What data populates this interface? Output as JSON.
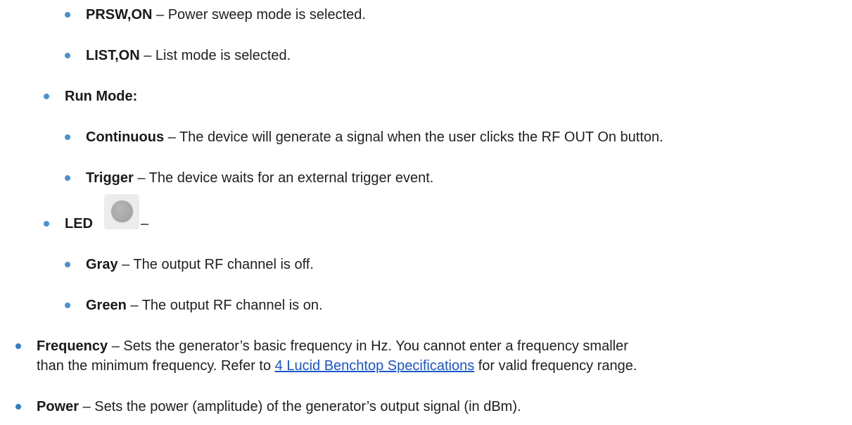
{
  "items": [
    {
      "term": "PRSW,ON",
      "sep": " – ",
      "desc": "Power sweep mode is selected."
    },
    {
      "term": "LIST,ON",
      "sep": " – ",
      "desc": "List mode is selected."
    },
    {
      "term": "Run Mode:"
    },
    {
      "term": "Continuous",
      "sep": " – ",
      "desc": "The device will generate a signal when the user clicks the RF OUT On button."
    },
    {
      "term": "Trigger",
      "sep": " – ",
      "desc": "The device waits for an external trigger event."
    },
    {
      "term": "LED",
      "after": " –"
    },
    {
      "term": "Gray",
      "sep": " – ",
      "desc": "The output RF channel is off."
    },
    {
      "term": "Green",
      "sep": " – ",
      "desc": "The output RF channel is on."
    },
    {
      "term": "Frequency",
      "sep": " – ",
      "desc": "Sets the generator’s basic frequency in Hz. You cannot enter a frequency smaller"
    },
    {
      "cont_pre": "than the minimum frequency. Refer to ",
      "link": "4 Lucid Benchtop Specifications",
      "cont_post": " for valid frequency range."
    },
    {
      "term": "Power",
      "sep": " – ",
      "desc": "Sets the power (amplitude) of the generator’s output signal (in dBm)."
    }
  ],
  "colors": {
    "bullet": "#4a90d0",
    "link": "#1a56c8",
    "text": "#1f1f1f"
  },
  "icons": {
    "led": "led-indicator-icon"
  }
}
